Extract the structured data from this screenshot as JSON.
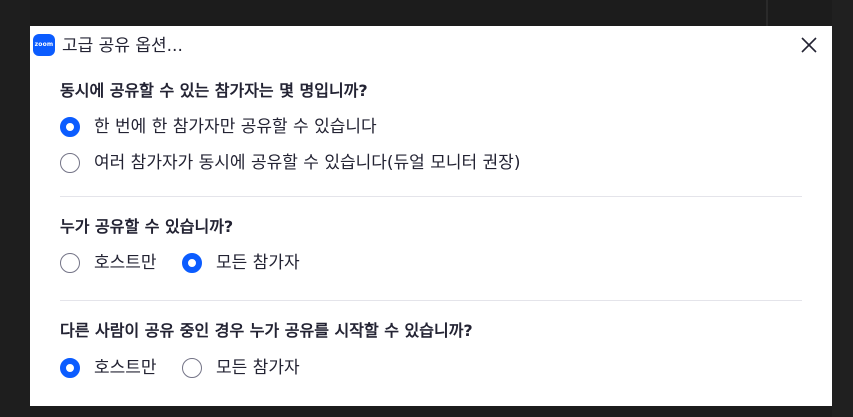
{
  "window": {
    "title": "고급 공유 옵션...",
    "logo_text": "zoom",
    "close_glyph": "x-icon"
  },
  "colors": {
    "accent": "#0b5cff",
    "text": "#232333",
    "radio_border": "#747487",
    "separator": "#e4e4ea"
  },
  "section1": {
    "title": "동시에 공유할 수 있는 참가자는 몇 명입니까?",
    "options": [
      {
        "label": "한 번에 한 참가자만 공유할 수 있습니다",
        "checked": true
      },
      {
        "label": "여러 참가자가 동시에 공유할 수 있습니다(듀얼 모니터 권장)",
        "checked": false
      }
    ]
  },
  "section2": {
    "title": "누가 공유할 수 있습니까?",
    "options": [
      {
        "label": "호스트만",
        "checked": false
      },
      {
        "label": "모든 참가자",
        "checked": true
      }
    ]
  },
  "section3": {
    "title": "다른 사람이 공유 중인 경우 누가 공유를 시작할 수 있습니까?",
    "options": [
      {
        "label": "호스트만",
        "checked": true
      },
      {
        "label": "모든 참가자",
        "checked": false
      }
    ]
  }
}
